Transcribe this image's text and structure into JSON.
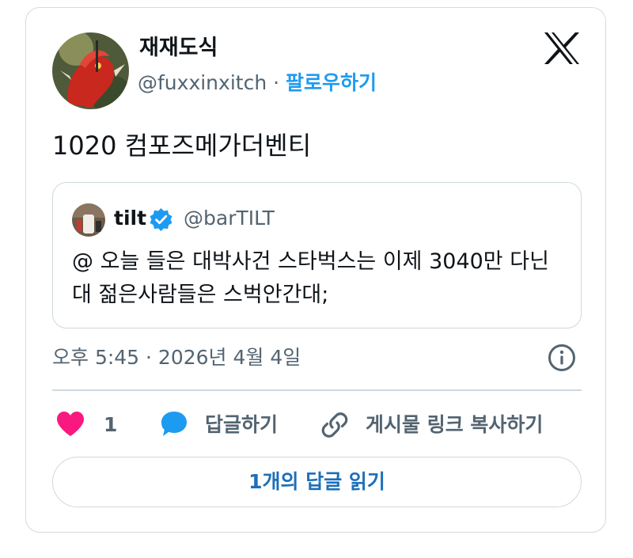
{
  "author": {
    "display_name": "재재도식",
    "handle": "@fuxxinxitch",
    "separator": " · ",
    "follow_label": "팔로우하기"
  },
  "tweet": {
    "text": "1020 컴포즈메가더벤티",
    "timestamp": "오후 5:45 · 2026년 4월 4일"
  },
  "quoted_tweet": {
    "display_name": "tilt",
    "handle": "@barTILT",
    "verified": true,
    "text": "@ 오늘 들은 대박사건 스타벅스는 이제 3040만 다닌대 젊은사람들은 스벅안간대;"
  },
  "actions": {
    "like_count": "1",
    "reply_label": "답글하기",
    "copy_link_label": "게시물 링크 복사하기"
  },
  "read_replies_label": "1개의 답글 읽기",
  "icons": {
    "brand": "x-logo-icon",
    "verified": "verified-badge-icon",
    "info": "info-icon",
    "like": "heart-icon",
    "reply": "speech-bubble-icon",
    "link": "link-icon"
  },
  "colors": {
    "accent": "#1d9bf0",
    "like": "#f91880",
    "secondary_text": "#536471",
    "border": "#cfd9de"
  }
}
